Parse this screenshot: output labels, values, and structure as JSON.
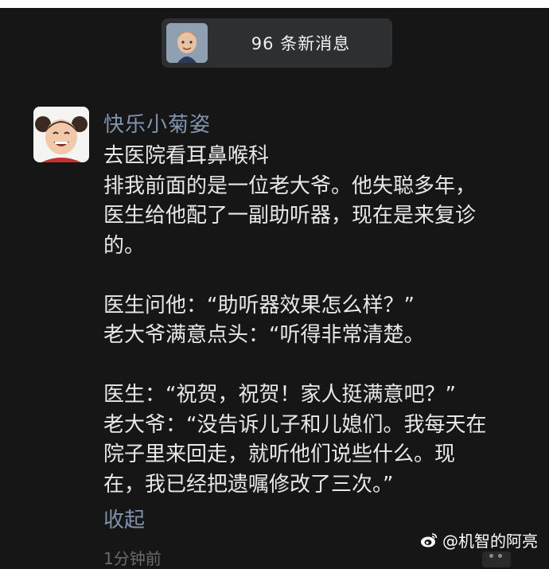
{
  "banner": {
    "new_messages": "96 条新消息"
  },
  "post": {
    "username": "快乐小菊姿",
    "lines": [
      "去医院看耳鼻喉科",
      "排我前面的是一位老大爷。他失聪多年，",
      "医生给他配了一副助听器，现在是来复诊",
      "的。",
      "",
      "医生问他：“助听器效果怎么样？”",
      "老大爷满意点头：“听得非常清楚。",
      "",
      "医生：“祝贺，祝贺！家人挺满意吧？”",
      "老大爷：“没告诉儿子和儿媳们。我每天在",
      "院子里来回走，就听他们说些什么。现",
      "在，我已经把遗嘱修改了三次。”"
    ],
    "collapse_label": "收起",
    "timestamp": "1分钟前"
  },
  "watermark": {
    "text": "@机智的阿亮",
    "icon": "weibo-logo-icon"
  }
}
